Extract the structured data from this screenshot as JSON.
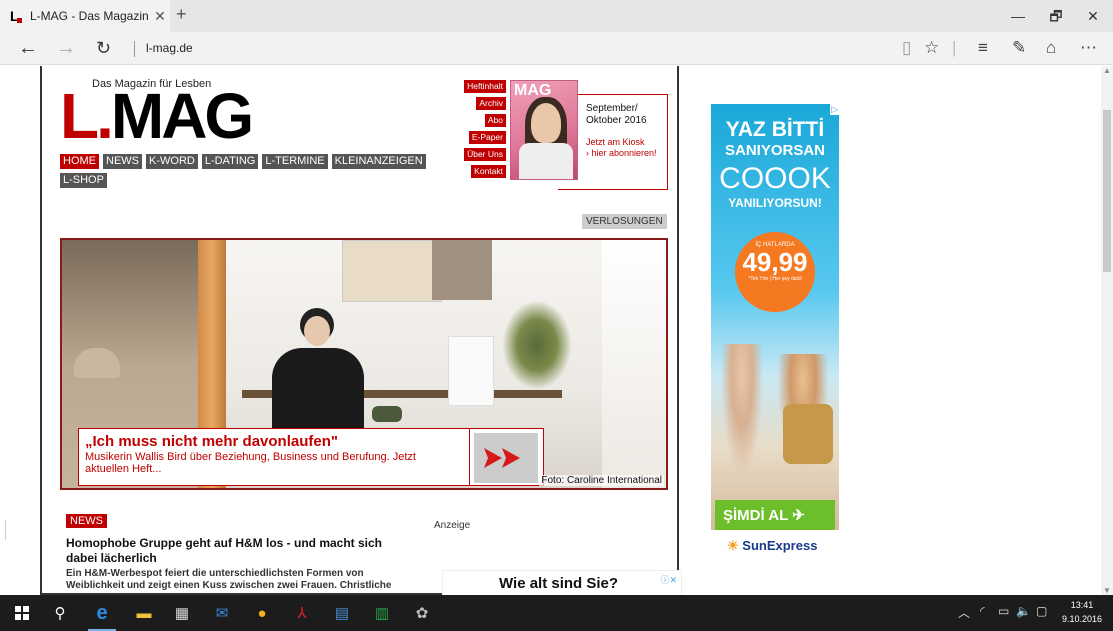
{
  "browser": {
    "tab_title": "L-MAG - Das Magazin f",
    "tab_close": "✕",
    "new_tab": "+",
    "url": "l-mag.de",
    "window": {
      "minimize": "—",
      "maximize": "🗗",
      "close": "✕"
    }
  },
  "site": {
    "tagline": "Das Magazin für Lesben",
    "logo_dot": "L.",
    "logo_text": "MAG",
    "nav": [
      "HOME",
      "NEWS",
      "K-WORD",
      "L-DATING",
      "L-TERMINE",
      "KLEINANZEIGEN",
      "L-SHOP"
    ],
    "issue_nav": [
      "Heftinhalt",
      "Archiv",
      "Abo",
      "E-Paper",
      "Über Uns",
      "Kontakt"
    ],
    "cover_title": "MAG",
    "issue_date_1": "September/",
    "issue_date_2": "Oktober 2016",
    "kiosk_1": "Jetzt am Kiosk",
    "kiosk_2": "› hier abonnieren!",
    "verlosungen": "VERLOSUNGEN",
    "hero": {
      "headline": "„Ich muss nicht mehr davonlaufen\"",
      "teaser": "Musikerin Wallis Bird über Beziehung, Business und Berufung. Jetzt aktuellen Heft...",
      "credit": "Foto: Caroline International"
    },
    "news_badge": "NEWS",
    "news_headline": "Homophobe Gruppe geht auf H&M los - und macht sich dabei lächerlich",
    "news_text": "Ein H&M-Werbespot feiert die unterschiedlichsten Formen von Weiblichkeit und zeigt einen Kuss zwischen zwei Frauen. Christliche",
    "anzeige": "Anzeige",
    "ad_question": "Wie alt sind Sie?",
    "ad_choices": "ⓘ✕"
  },
  "side_ad": {
    "line1": "YAZ BİTTİ",
    "line2": "SANIYORSAN",
    "line3": "COOOK",
    "line4": "YANILIYORSUN!",
    "circle_top": "İÇ HATLARDA",
    "price": "49,99",
    "circle_small": "*Tek Yön | Her şey dahil",
    "cta": "ŞİMDİ AL",
    "brand": "SunExpress"
  },
  "taskbar": {
    "time": "13:41",
    "date": "9.10.2016"
  },
  "colors": {
    "accent_red": "#c00000",
    "nav_gray": "#555555",
    "taskbar": "#1c1c1c"
  }
}
